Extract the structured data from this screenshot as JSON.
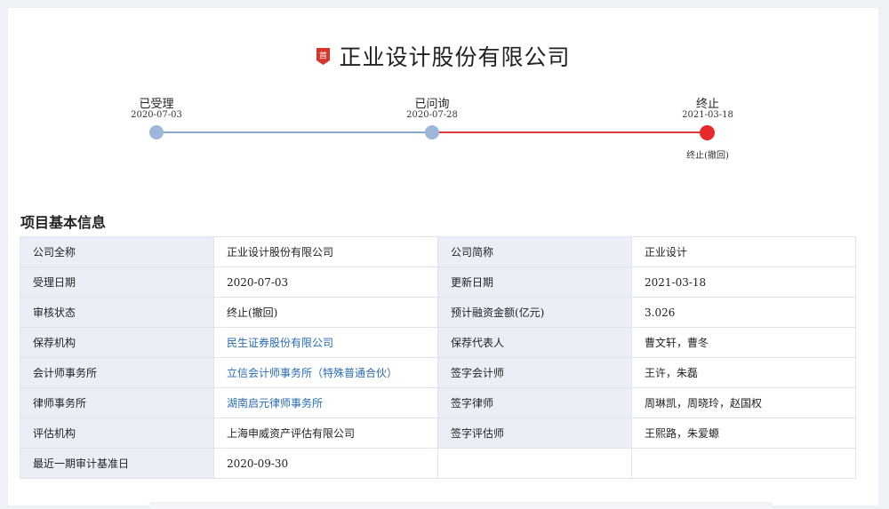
{
  "header": {
    "badge_text": "首",
    "title": "正业设计股份有限公司",
    "colors": {
      "badge": "#d9342b",
      "badge_text": "#ffffff"
    }
  },
  "timeline": {
    "steps": [
      {
        "label": "已受理",
        "date": "2020-07-03",
        "status": "done",
        "note": ""
      },
      {
        "label": "已问询",
        "date": "2020-07-28",
        "status": "done",
        "note": ""
      },
      {
        "label": "终止",
        "date": "2021-03-18",
        "status": "terminated",
        "note": "终止(撤回)"
      }
    ],
    "colors": {
      "done": "#9db6d9",
      "done_line": "#8aa8d0",
      "terminated": "#e82a2a",
      "terminated_line": "#e03b3b"
    }
  },
  "section": {
    "title": "项目基本信息"
  },
  "info_rows": [
    {
      "k1": "公司全称",
      "v1": "正业设计股份有限公司",
      "k2": "公司简称",
      "v2": "正业设计"
    },
    {
      "k1": "受理日期",
      "v1": "2020-07-03",
      "k2": "更新日期",
      "v2": "2021-03-18"
    },
    {
      "k1": "审核状态",
      "v1": "终止(撤回)",
      "k2": "预计融资金额(亿元)",
      "v2": "3.026"
    },
    {
      "k1": "保荐机构",
      "v1": "民生证券股份有限公司",
      "k2": "保荐代表人",
      "v2": "曹文轩，曹冬"
    },
    {
      "k1": "会计师事务所",
      "v1": "立信会计师事务所（特殊普通合伙）",
      "k2": "签字会计师",
      "v2": "王许，朱磊"
    },
    {
      "k1": "律师事务所",
      "v1": "湖南启元律师事务所",
      "k2": "签字律师",
      "v2": "周琳凯，周晓玲，赵国权"
    },
    {
      "k1": "评估机构",
      "v1": "上海申威资产评估有限公司",
      "k2": "签字评估师",
      "v2": "王熙路，朱爱螈"
    },
    {
      "k1": "最近一期审计基准日",
      "v1": "2020-09-30",
      "k2": "",
      "v2": ""
    }
  ],
  "link_color": "#2a6bb5"
}
